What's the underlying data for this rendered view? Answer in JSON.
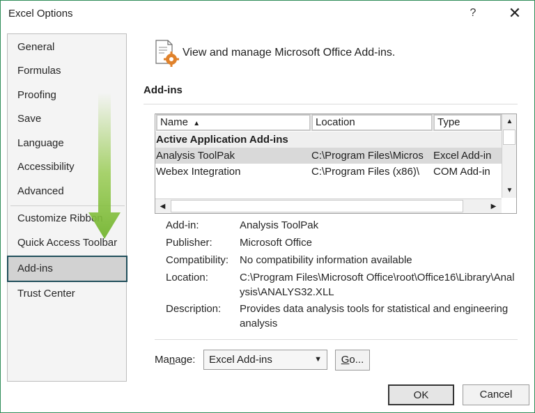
{
  "window": {
    "title": "Excel Options",
    "help": "?",
    "close": "✕"
  },
  "sidebar": {
    "items": [
      {
        "label": "General"
      },
      {
        "label": "Formulas"
      },
      {
        "label": "Proofing"
      },
      {
        "label": "Save"
      },
      {
        "label": "Language"
      },
      {
        "label": "Accessibility"
      },
      {
        "label": "Advanced"
      },
      {
        "label": "Customize Ribbon"
      },
      {
        "label": "Quick Access Toolbar"
      },
      {
        "label": "Add-ins"
      },
      {
        "label": "Trust Center"
      }
    ],
    "selected": "Add-ins",
    "arrow_icon": "green-down-arrow-icon",
    "arrow_color": "#8dc63f"
  },
  "header": {
    "text": "View and manage Microsoft Office Add-ins.",
    "icon": "addins-gear-icon"
  },
  "section": {
    "title": "Add-ins"
  },
  "table": {
    "columns": {
      "name": "Name",
      "location": "Location",
      "type": "Type"
    },
    "sort_indicator": "▲",
    "group_label": "Active Application Add-ins",
    "rows": [
      {
        "name": "Analysis ToolPak",
        "location": "C:\\Program Files\\Micros",
        "type": "Excel Add-in"
      },
      {
        "name": "Webex Integration",
        "location": "C:\\Program Files (x86)\\",
        "type": "COM Add-in"
      }
    ],
    "scroll": {
      "up": "▲",
      "down": "▼",
      "left": "◀",
      "right": "▶"
    }
  },
  "details": {
    "addin_label": "Add-in:",
    "addin_value": "Analysis ToolPak",
    "publisher_label": "Publisher:",
    "publisher_value": "Microsoft Office",
    "compat_label": "Compatibility:",
    "compat_value": "No compatibility information available",
    "location_label": "Location:",
    "location_value": "C:\\Program Files\\Microsoft Office\\root\\Office16\\Library\\Analysis\\ANALYS32.XLL",
    "description_label": "Description:",
    "description_value": "Provides data analysis tools for statistical and engineering analysis"
  },
  "manage": {
    "label_prefix": "Ma",
    "label_underlined": "n",
    "label_suffix": "age:",
    "selected": "Excel Add-ins",
    "caret": "▼",
    "go_underlined": "G",
    "go_suffix": "o..."
  },
  "buttons": {
    "ok": "OK",
    "cancel": "Cancel"
  }
}
